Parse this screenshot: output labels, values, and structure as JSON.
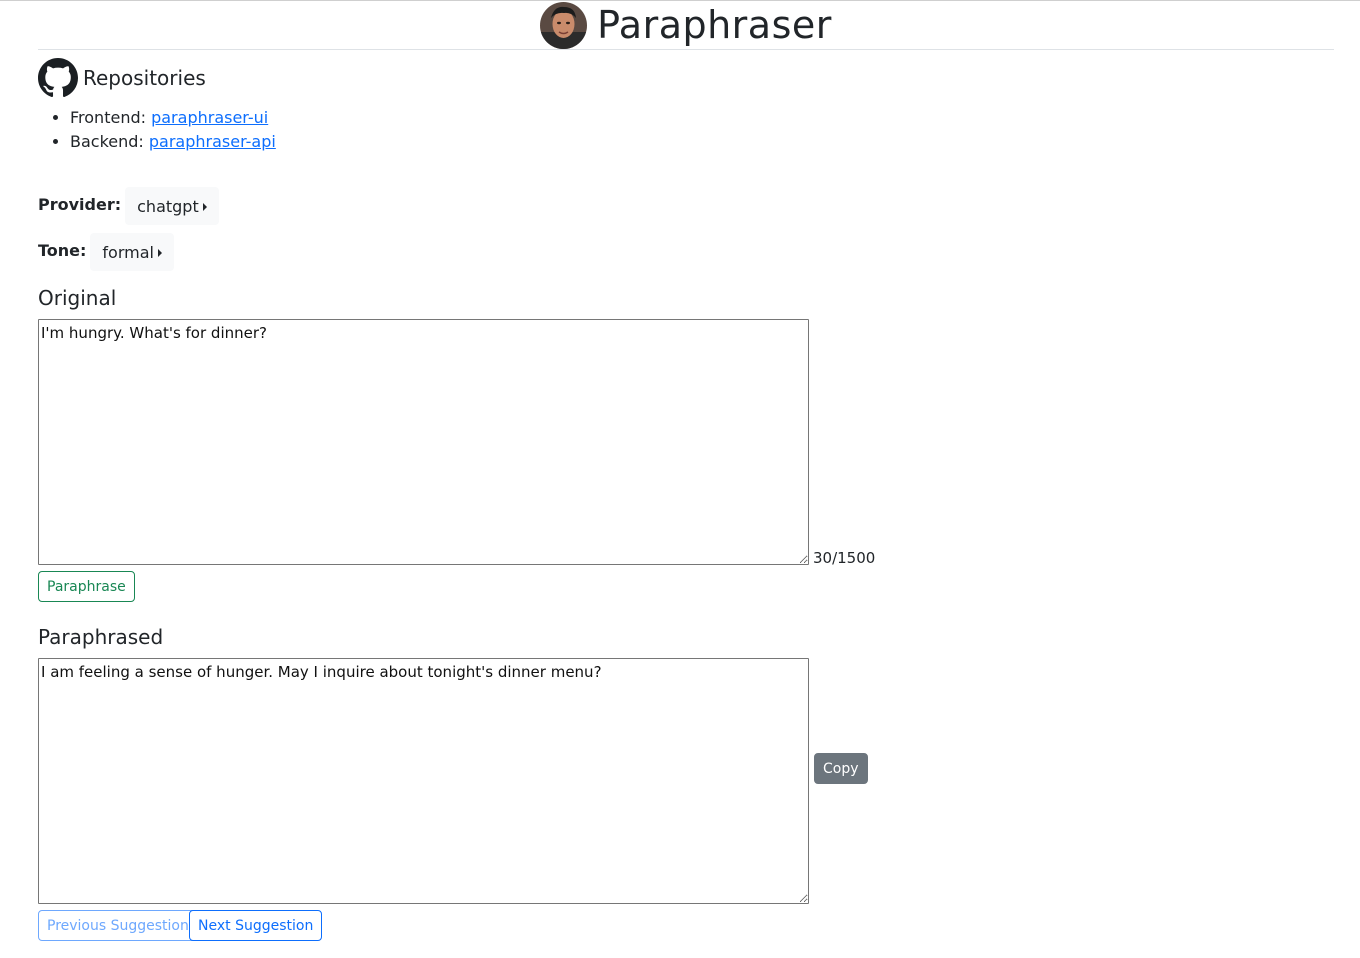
{
  "header": {
    "title": "Paraphraser"
  },
  "repositories": {
    "title": "Repositories",
    "items": [
      {
        "label": "Frontend: ",
        "link_text": "paraphraser-ui"
      },
      {
        "label": "Backend: ",
        "link_text": "paraphraser-api"
      }
    ]
  },
  "settings": {
    "provider_label": "Provider:",
    "provider_value": "chatgpt",
    "tone_label": "Tone:",
    "tone_value": "formal"
  },
  "original": {
    "title": "Original",
    "text": "I'm hungry. What's for dinner?",
    "char_count": "30/1500",
    "paraphrase_button": "Paraphrase"
  },
  "paraphrased": {
    "title": "Paraphrased",
    "text": "I am feeling a sense of hunger. May I inquire about tonight's dinner menu?",
    "copy_button": "Copy",
    "previous_button": "Previous Suggestion",
    "next_button": "Next Suggestion"
  },
  "colors": {
    "success": "#198754",
    "primary": "#0d6efd",
    "secondary": "#6c757d"
  }
}
